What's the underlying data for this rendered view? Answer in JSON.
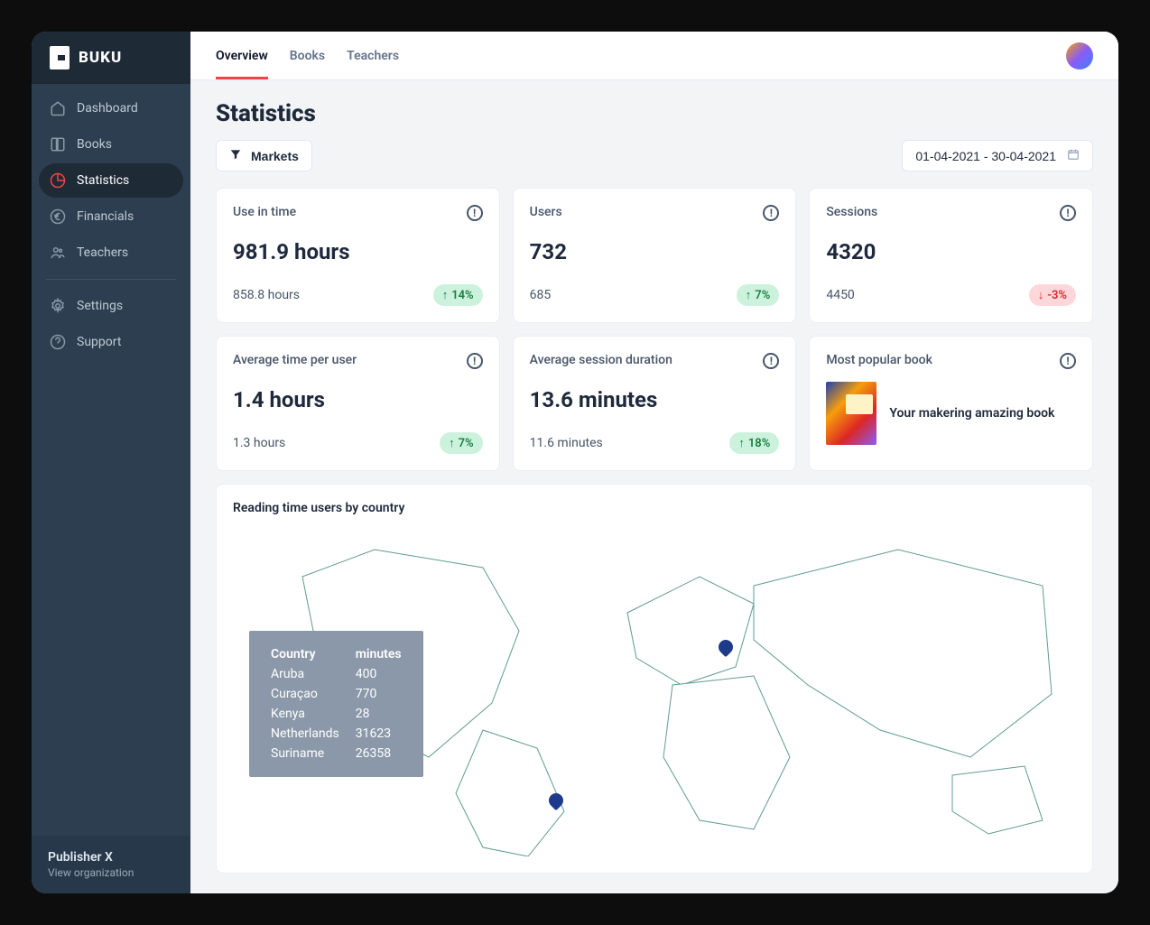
{
  "brand": "BUKU",
  "sidebar": {
    "items": [
      {
        "label": "Dashboard"
      },
      {
        "label": "Books"
      },
      {
        "label": "Statistics"
      },
      {
        "label": "Financials"
      },
      {
        "label": "Teachers"
      }
    ],
    "secondary": [
      {
        "label": "Settings"
      },
      {
        "label": "Support"
      }
    ]
  },
  "org": {
    "name": "Publisher X",
    "link": "View organization"
  },
  "tabs": [
    {
      "label": "Overview",
      "active": true
    },
    {
      "label": "Books"
    },
    {
      "label": "Teachers"
    }
  ],
  "page_title": "Statistics",
  "filter_label": "Markets",
  "date_range": "01-04-2021 - 30-04-2021",
  "stats": {
    "use_in_time": {
      "title": "Use in time",
      "value": "981.9 hours",
      "prev": "858.8 hours",
      "delta": "14%",
      "dir": "up"
    },
    "users": {
      "title": "Users",
      "value": "732",
      "prev": "685",
      "delta": "7%",
      "dir": "up"
    },
    "sessions": {
      "title": "Sessions",
      "value": "4320",
      "prev": "4450",
      "delta": "-3%",
      "dir": "down"
    },
    "avg_time": {
      "title": "Average time per user",
      "value": "1.4 hours",
      "prev": "1.3 hours",
      "delta": "7%",
      "dir": "up"
    },
    "avg_session": {
      "title": "Average session duration",
      "value": "13.6 minutes",
      "prev": "11.6 minutes",
      "delta": "18%",
      "dir": "up"
    },
    "popular": {
      "title": "Most popular book",
      "book_title": "Your makering amazing book"
    }
  },
  "map": {
    "title": "Reading time users by country",
    "header_country": "Country",
    "header_minutes": "minutes",
    "rows": [
      {
        "country": "Aruba",
        "minutes": "400"
      },
      {
        "country": "Curaçao",
        "minutes": "770"
      },
      {
        "country": "Kenya",
        "minutes": "28"
      },
      {
        "country": "Netherlands",
        "minutes": "31623"
      },
      {
        "country": "Suriname",
        "minutes": "26358"
      }
    ]
  }
}
